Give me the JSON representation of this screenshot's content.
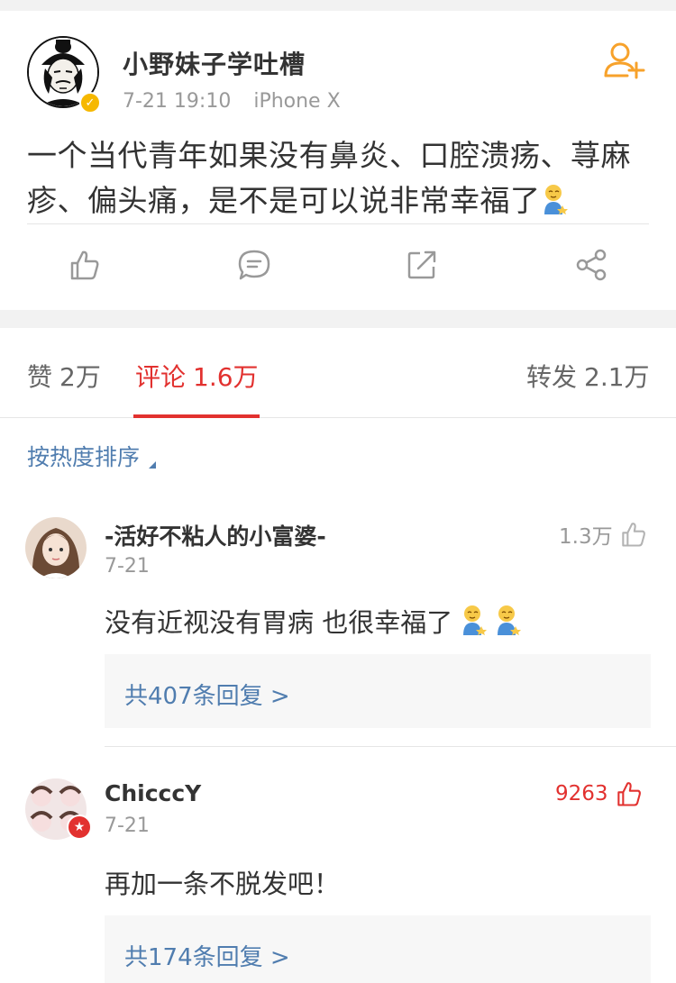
{
  "post": {
    "author": "小野妹子学吐槽",
    "time": "7-21 19:10",
    "device": "iPhone X",
    "text": "一个当代青年如果没有鼻炎、口腔溃疡、荨麻疹、偏头痛，是不是可以说非常幸福了",
    "emoji": "blessed-emoji"
  },
  "tabs": {
    "likes_label": "赞",
    "likes_count": "2万",
    "comments_label": "评论",
    "comments_count": "1.6万",
    "reposts_label": "转发",
    "reposts_count": "2.1万"
  },
  "sort_label": "按热度排序",
  "comments": [
    {
      "name": "-活好不粘人的小富婆-",
      "date": "7-21",
      "likes": "1.3万",
      "text": "没有近视没有胃病 也很幸福了",
      "replies": "共407条回复 >"
    },
    {
      "name": "ChicccY",
      "date": "7-21",
      "likes": "9263",
      "text": "再加一条不脱发吧！",
      "replies": "共174条回复 >"
    }
  ],
  "colors": {
    "accent_red": "#e2312f",
    "link_blue": "#507daf",
    "verified_gold": "#f6b800",
    "follow_orange": "#f7a22b"
  }
}
